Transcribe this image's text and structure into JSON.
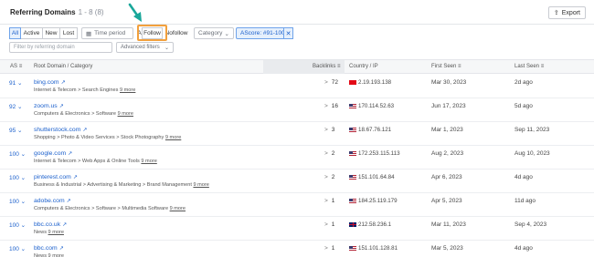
{
  "header": {
    "title": "Referring Domains",
    "count": "1 - 8 (8)",
    "export_label": "Export"
  },
  "filters": {
    "segments": [
      "All",
      "Active",
      "New",
      "Lost"
    ],
    "time_period_label": "Time period",
    "link_types": [
      "All",
      "Follow",
      "Nofollow"
    ],
    "category_label": "Category",
    "chip_label": "AScore: #91-100",
    "search_placeholder": "Filter by referring domain",
    "advanced_label": "Advanced filters"
  },
  "table": {
    "columns": [
      "AS",
      "Root Domain / Category",
      "Backlinks",
      "Country / IP",
      "First Seen",
      "Last Seen"
    ],
    "more_label": "9 more",
    "rows": [
      {
        "as": "91",
        "domain": "bing.com",
        "category": "Internet & Telecom > Search Engines",
        "backlinks": "72",
        "country": "tr",
        "ip": "2.19.193.138",
        "first_seen": "Mar 30, 2023",
        "last_seen": "2d ago"
      },
      {
        "as": "92",
        "domain": "zoom.us",
        "category": "Computers & Electronics > Software",
        "backlinks": "16",
        "country": "us",
        "ip": "170.114.52.63",
        "first_seen": "Jun 17, 2023",
        "last_seen": "5d ago"
      },
      {
        "as": "95",
        "domain": "shutterstock.com",
        "category": "Shopping > Photo & Video Services > Stock Photography",
        "backlinks": "3",
        "country": "us",
        "ip": "18.67.76.121",
        "first_seen": "Mar 1, 2023",
        "last_seen": "Sep 11, 2023"
      },
      {
        "as": "100",
        "domain": "google.com",
        "category": "Internet & Telecom > Web Apps & Online Tools",
        "backlinks": "2",
        "country": "us",
        "ip": "172.253.115.113",
        "first_seen": "Aug 2, 2023",
        "last_seen": "Aug 10, 2023"
      },
      {
        "as": "100",
        "domain": "pinterest.com",
        "category": "Business & Industrial > Advertising & Marketing > Brand Management",
        "backlinks": "2",
        "country": "us",
        "ip": "151.101.64.84",
        "first_seen": "Apr 6, 2023",
        "last_seen": "4d ago"
      },
      {
        "as": "100",
        "domain": "adobe.com",
        "category": "Computers & Electronics > Software > Multimedia Software",
        "backlinks": "1",
        "country": "us",
        "ip": "184.25.119.179",
        "first_seen": "Apr 5, 2023",
        "last_seen": "11d ago"
      },
      {
        "as": "100",
        "domain": "bbc.co.uk",
        "category": "News",
        "backlinks": "1",
        "country": "gb",
        "ip": "212.58.236.1",
        "first_seen": "Mar 11, 2023",
        "last_seen": "Sep 4, 2023"
      },
      {
        "as": "100",
        "domain": "bbc.com",
        "category": "News",
        "backlinks": "1",
        "country": "us",
        "ip": "151.101.128.81",
        "first_seen": "Mar 5, 2023",
        "last_seen": "4d ago"
      }
    ]
  },
  "colors": {
    "accent": "#1a5fcc",
    "highlight": "#f2a03d",
    "arrow": "#1aa79a"
  }
}
